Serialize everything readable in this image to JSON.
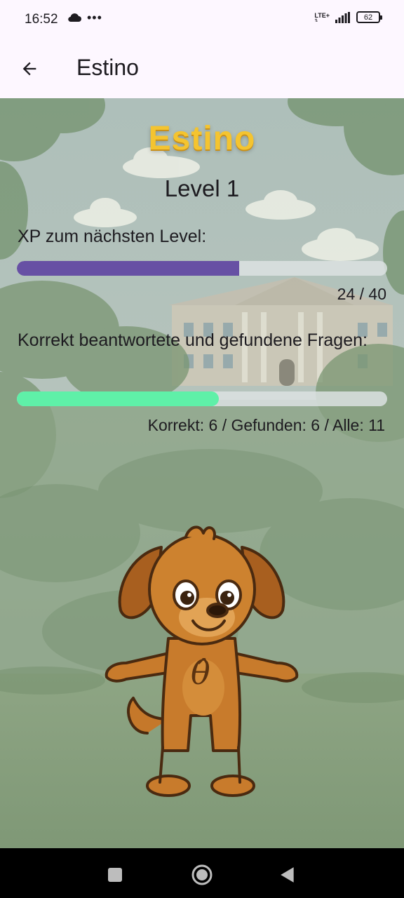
{
  "status_bar": {
    "time": "16:52",
    "network": "LTE+",
    "battery": "62",
    "icons": [
      "cloud-icon",
      "more-dots-icon",
      "signal-icon",
      "battery-icon"
    ]
  },
  "app_bar": {
    "title": "Estino",
    "back_icon": "arrow-back-icon"
  },
  "game": {
    "title": "Estino",
    "level": "Level 1",
    "xp": {
      "label": "XP zum nächsten Level:",
      "current": 24,
      "max": 40,
      "count_text": "24 / 40",
      "color": "#6750a4"
    },
    "questions": {
      "label": "Korrekt beantwortete und gefundene Fragen:",
      "correct": 6,
      "found": 6,
      "total": 11,
      "stats_text": "Korrekt: 6 / Gefunden: 6 / Alle: 11",
      "color": "#5ff0a8"
    },
    "mascot_symbol": "θ̂"
  },
  "nav_bar": {
    "buttons": [
      "recents-square-icon",
      "home-circle-icon",
      "back-triangle-icon"
    ]
  }
}
